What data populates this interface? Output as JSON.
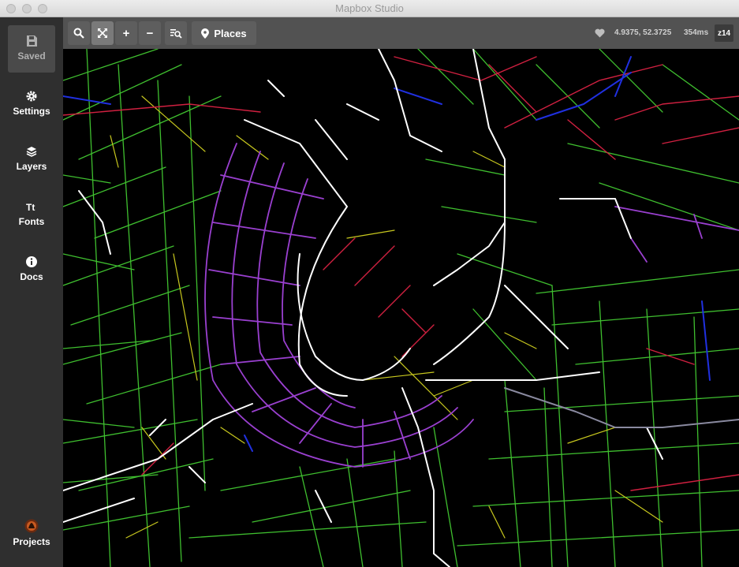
{
  "window": {
    "title": "Mapbox Studio"
  },
  "sidebar": {
    "items": [
      {
        "label": "Saved",
        "icon": "save-icon"
      },
      {
        "label": "Settings",
        "icon": "gear-icon"
      },
      {
        "label": "Layers",
        "icon": "layers-icon"
      },
      {
        "label": "Fonts",
        "icon": "fonts-icon"
      },
      {
        "label": "Docs",
        "icon": "info-icon"
      }
    ],
    "projects": {
      "label": "Projects",
      "icon": "projects-avatar-icon"
    }
  },
  "toolbar": {
    "search": "search-icon",
    "fit": "expand-icon",
    "zoom_in": "+",
    "zoom_out": "−",
    "inspect": "inspect-icon",
    "places_label": "Places",
    "coords": "4.9375, 52.3725",
    "render_time": "354ms",
    "zoom_level": "z14"
  },
  "colors": {
    "sidebar_bg": "#2f2f2f",
    "toolbar_bg": "#525252",
    "map_bg": "#000000",
    "road_green": "#3fbf2f",
    "road_yellow": "#d8c820",
    "road_purple": "#9a40d0",
    "road_red": "#d02040",
    "road_white": "#ffffff",
    "road_blue": "#2030e0"
  }
}
